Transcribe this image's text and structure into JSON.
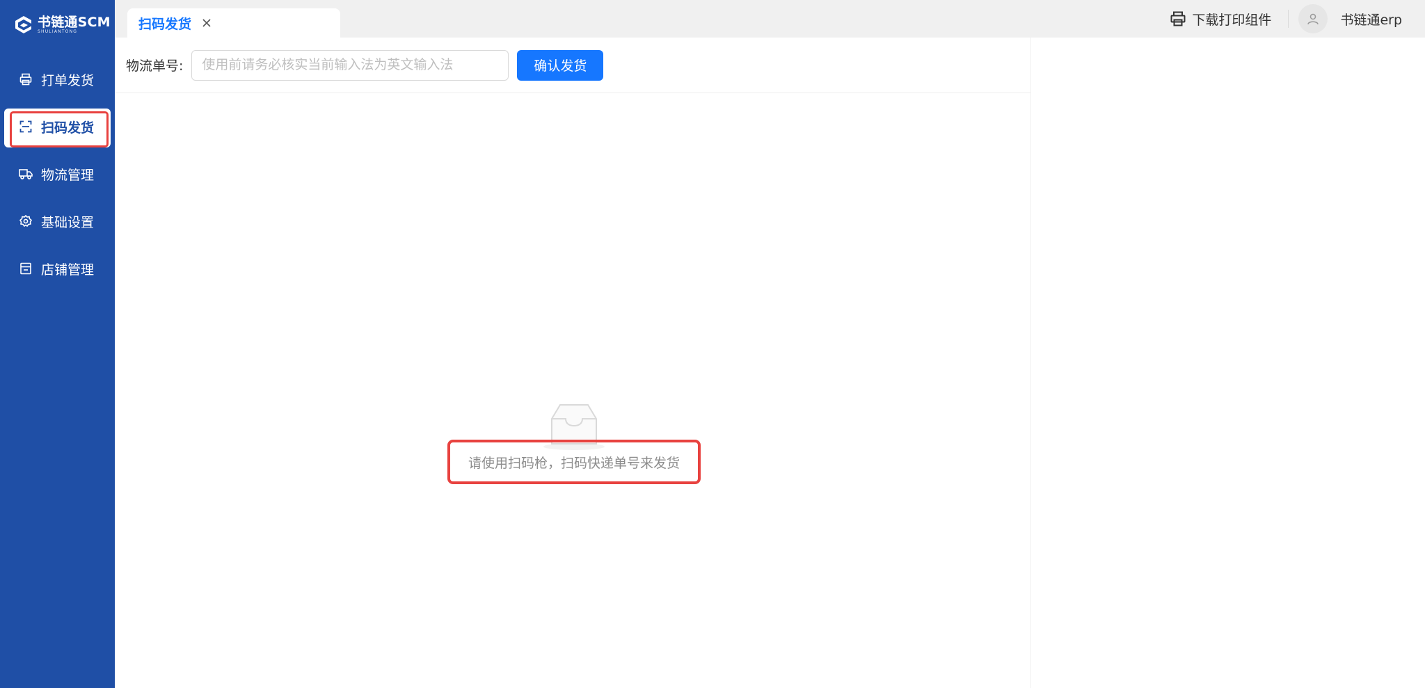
{
  "app": {
    "logo_text": "书链通SCM",
    "logo_sub": "SHULIANTONG"
  },
  "sidebar": {
    "items": [
      {
        "label": "打单发货",
        "icon": "printer-icon",
        "active": false
      },
      {
        "label": "扫码发货",
        "icon": "scan-icon",
        "active": true
      },
      {
        "label": "物流管理",
        "icon": "truck-icon",
        "active": false
      },
      {
        "label": "基础设置",
        "icon": "gear-icon",
        "active": false
      },
      {
        "label": "店铺管理",
        "icon": "store-icon",
        "active": false
      }
    ]
  },
  "tabs": [
    {
      "label": "扫码发货",
      "closable": true
    }
  ],
  "header": {
    "download_label": "下载打印组件",
    "username": "书链通erp"
  },
  "toolbar": {
    "field_label": "物流单号:",
    "input_value": "",
    "input_placeholder": "使用前请务必核实当前输入法为英文输入法",
    "confirm_label": "确认发货"
  },
  "empty_state": {
    "message": "请使用扫码枪，扫码快递单号来发货"
  },
  "colors": {
    "sidebar_bg": "#1f4fa6",
    "accent": "#1677ff",
    "highlight": "#e8423f"
  }
}
